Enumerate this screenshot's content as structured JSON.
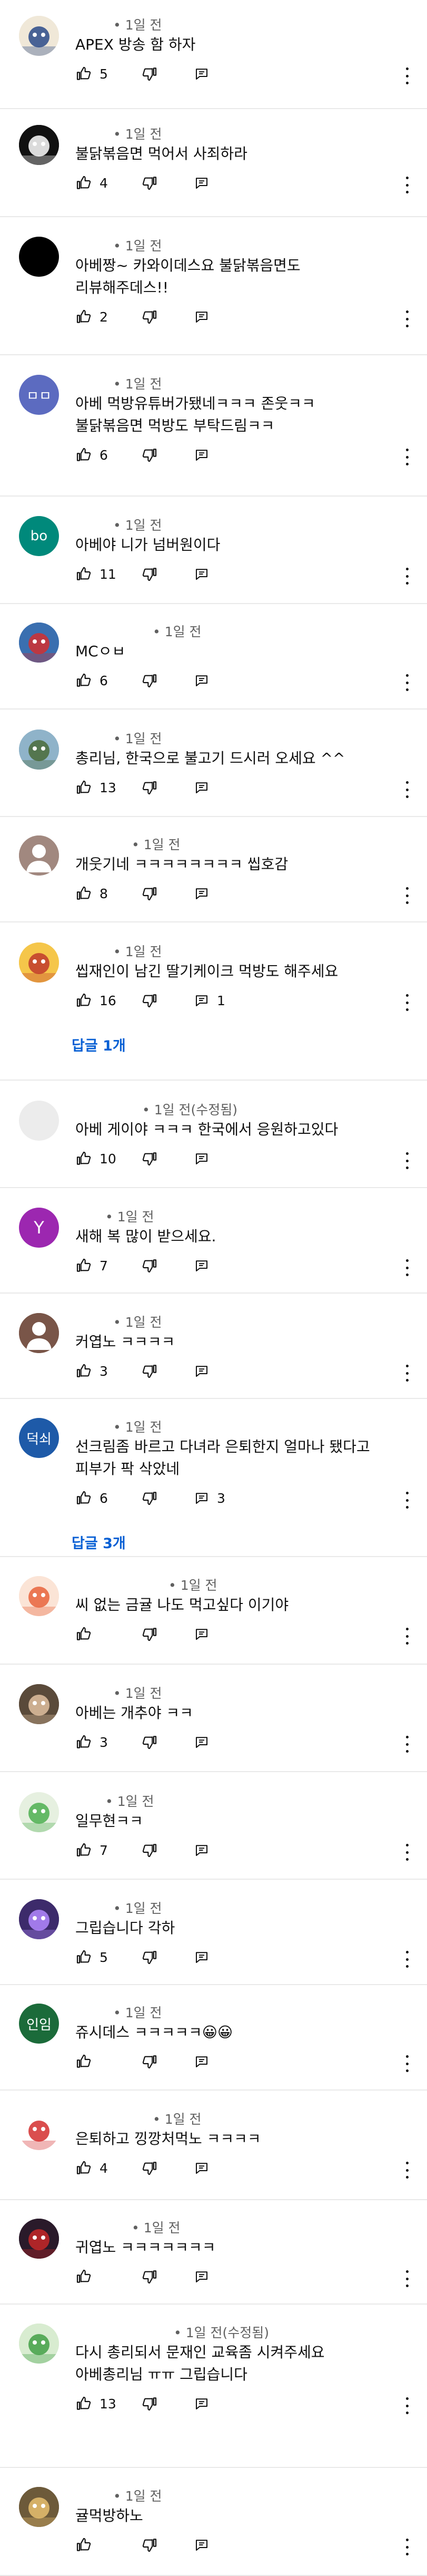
{
  "comments": [
    {
      "time": "• 1일 전",
      "text": [
        "APEX 방송 함 하자"
      ],
      "likes": "5",
      "replies": "",
      "more_replies": "",
      "avatar": {
        "kind": "img",
        "bg": "#f0e8d8",
        "fg": "#2a4a8a",
        "label": ""
      }
    },
    {
      "time": "• 1일 전",
      "text": [
        "불닭볶음면 먹어서 사죄하라"
      ],
      "likes": "4",
      "replies": "",
      "more_replies": "",
      "avatar": {
        "kind": "img",
        "bg": "#111111",
        "fg": "#ffffff",
        "label": ""
      }
    },
    {
      "time": "• 1일 전",
      "text": [
        "아베짱~ 카와이데스요 불닭볶음면도",
        "리뷰해주데스!!"
      ],
      "likes": "2",
      "replies": "",
      "more_replies": "",
      "avatar": {
        "kind": "solid",
        "bg": "#000000",
        "fg": "#ffffff",
        "label": ""
      }
    },
    {
      "time": "• 1일 전",
      "text": [
        "아베 먹방유튜버가됐네ㅋㅋㅋ 존웃ㅋㅋ",
        "불닭볶음면 먹방도 부탁드림ㅋㅋ"
      ],
      "likes": "6",
      "replies": "",
      "more_replies": "",
      "avatar": {
        "kind": "letter",
        "bg": "#5c6bc0",
        "fg": "#ffffff",
        "label": "ㅁㅁ"
      }
    },
    {
      "time": "• 1일 전",
      "text": [
        "아베야 니가 넘버원이다"
      ],
      "likes": "11",
      "replies": "",
      "more_replies": "",
      "avatar": {
        "kind": "letter",
        "bg": "#00897b",
        "fg": "#ffffff",
        "label": "bo"
      }
    },
    {
      "time": "• 1일 전",
      "text": [
        "MCㅇㅂ"
      ],
      "likes": "6",
      "replies": "",
      "more_replies": "",
      "avatar": {
        "kind": "img",
        "bg": "#3a6fb0",
        "fg": "#d32f2f",
        "label": ""
      }
    },
    {
      "time": "• 1일 전",
      "text": [
        "총리님, 한국으로 불고기 드시러 오세요 ^^"
      ],
      "likes": "13",
      "replies": "",
      "more_replies": "",
      "avatar": {
        "kind": "img",
        "bg": "#8fb3c9",
        "fg": "#4a6b3a",
        "label": ""
      }
    },
    {
      "time": "• 1일 전",
      "text": [
        "개웃기네 ㅋㅋㅋㅋㅋㅋㅋㅋ 씹호감"
      ],
      "likes": "8",
      "replies": "",
      "more_replies": "",
      "avatar": {
        "kind": "person",
        "bg": "#a1887f",
        "fg": "#ffffff",
        "label": ""
      }
    },
    {
      "time": "• 1일 전",
      "text": [
        "씹재인이 남긴 딸기케이크 먹방도 해주세요"
      ],
      "likes": "16",
      "replies": "1",
      "more_replies": "답글 1개",
      "avatar": {
        "kind": "img",
        "bg": "#f5c64a",
        "fg": "#c0392b",
        "label": ""
      }
    },
    {
      "time": "• 1일 전(수정됨)",
      "text": [
        "아베 게이야 ㅋㅋㅋ 한국에서 응원하고있다"
      ],
      "likes": "10",
      "replies": "",
      "more_replies": "",
      "avatar": {
        "kind": "solid",
        "bg": "#ececec",
        "fg": "#ffffff",
        "label": ""
      }
    },
    {
      "time": "• 1일 전",
      "text": [
        "새해 복 많이 받으세요."
      ],
      "likes": "7",
      "replies": "",
      "more_replies": "",
      "avatar": {
        "kind": "letter",
        "bg": "#9c27b0",
        "fg": "#ffffff",
        "label": "Y"
      }
    },
    {
      "time": "• 1일 전",
      "text": [
        "커엽노 ㅋㅋㅋㅋ"
      ],
      "likes": "3",
      "replies": "",
      "more_replies": "",
      "avatar": {
        "kind": "person",
        "bg": "#795548",
        "fg": "#ffffff",
        "label": ""
      }
    },
    {
      "time": "• 1일 전",
      "text": [
        "선크림좀 바르고 다녀라   은퇴한지 얼마나 됐다고",
        "피부가 팍 삭았네"
      ],
      "likes": "6",
      "replies": "3",
      "more_replies": "답글 3개",
      "avatar": {
        "kind": "letter",
        "bg": "#1e5aa8",
        "fg": "#ffffff",
        "label": "덕쇠"
      }
    },
    {
      "time": "• 1일 전",
      "text": [
        "씨 없는 금귤 나도 먹고싶다 이기야"
      ],
      "likes": "",
      "replies": "",
      "more_replies": "",
      "avatar": {
        "kind": "img",
        "bg": "#fbe4d6",
        "fg": "#e8643c",
        "label": ""
      }
    },
    {
      "time": "• 1일 전",
      "text": [
        "아베는 개추야 ㅋㅋ"
      ],
      "likes": "3",
      "replies": "",
      "more_replies": "",
      "avatar": {
        "kind": "img",
        "bg": "#5a4a3a",
        "fg": "#e0c0a0",
        "label": ""
      }
    },
    {
      "time": "• 1일 전",
      "text": [
        "일무현ㅋㅋ"
      ],
      "likes": "7",
      "replies": "",
      "more_replies": "",
      "avatar": {
        "kind": "img",
        "bg": "#e6f0e0",
        "fg": "#4caf50",
        "label": ""
      }
    },
    {
      "time": "• 1일 전",
      "text": [
        "그립습니다 각하"
      ],
      "likes": "5",
      "replies": "",
      "more_replies": "",
      "avatar": {
        "kind": "img",
        "bg": "#3d2b6b",
        "fg": "#b388ff",
        "label": ""
      }
    },
    {
      "time": "• 1일 전",
      "text": [
        "쥬시데스 ㅋㅋㅋㅋㅋ😀😀"
      ],
      "likes": "",
      "replies": "",
      "more_replies": "",
      "avatar": {
        "kind": "letter",
        "bg": "#1b6b3a",
        "fg": "#ffffff",
        "label": "인임"
      }
    },
    {
      "time": "• 1일 전",
      "text": [
        "은퇴하고 낑깡처먹노 ㅋㅋㅋㅋ"
      ],
      "likes": "4",
      "replies": "",
      "more_replies": "",
      "avatar": {
        "kind": "img",
        "bg": "#ffffff",
        "fg": "#d32f2f",
        "label": ""
      }
    },
    {
      "time": "• 1일 전",
      "text": [
        "귀엽노 ㅋㅋㅋㅋㅋㅋㅋ"
      ],
      "likes": "",
      "replies": "",
      "more_replies": "",
      "avatar": {
        "kind": "img",
        "bg": "#2a1a2a",
        "fg": "#c62828",
        "label": ""
      }
    },
    {
      "time": "• 1일 전(수정됨)",
      "text": [
        "다시 총리되서 문재인 교육좀 시켜주세요",
        "아베총리님 ㅠㅠ 그립습니다"
      ],
      "likes": "13",
      "replies": "",
      "more_replies": "",
      "avatar": {
        "kind": "img",
        "bg": "#d8ecd0",
        "fg": "#43a047",
        "label": ""
      }
    },
    {
      "time": "• 1일 전",
      "text": [
        "귤먹방하노"
      ],
      "likes": "",
      "replies": "",
      "more_replies": "",
      "avatar": {
        "kind": "img",
        "bg": "#6d5a3a",
        "fg": "#e8c070",
        "label": ""
      }
    }
  ],
  "icons": {
    "like": "thumbs-up",
    "dislike": "thumbs-down",
    "reply": "reply-comment",
    "more": "more-vertical"
  }
}
